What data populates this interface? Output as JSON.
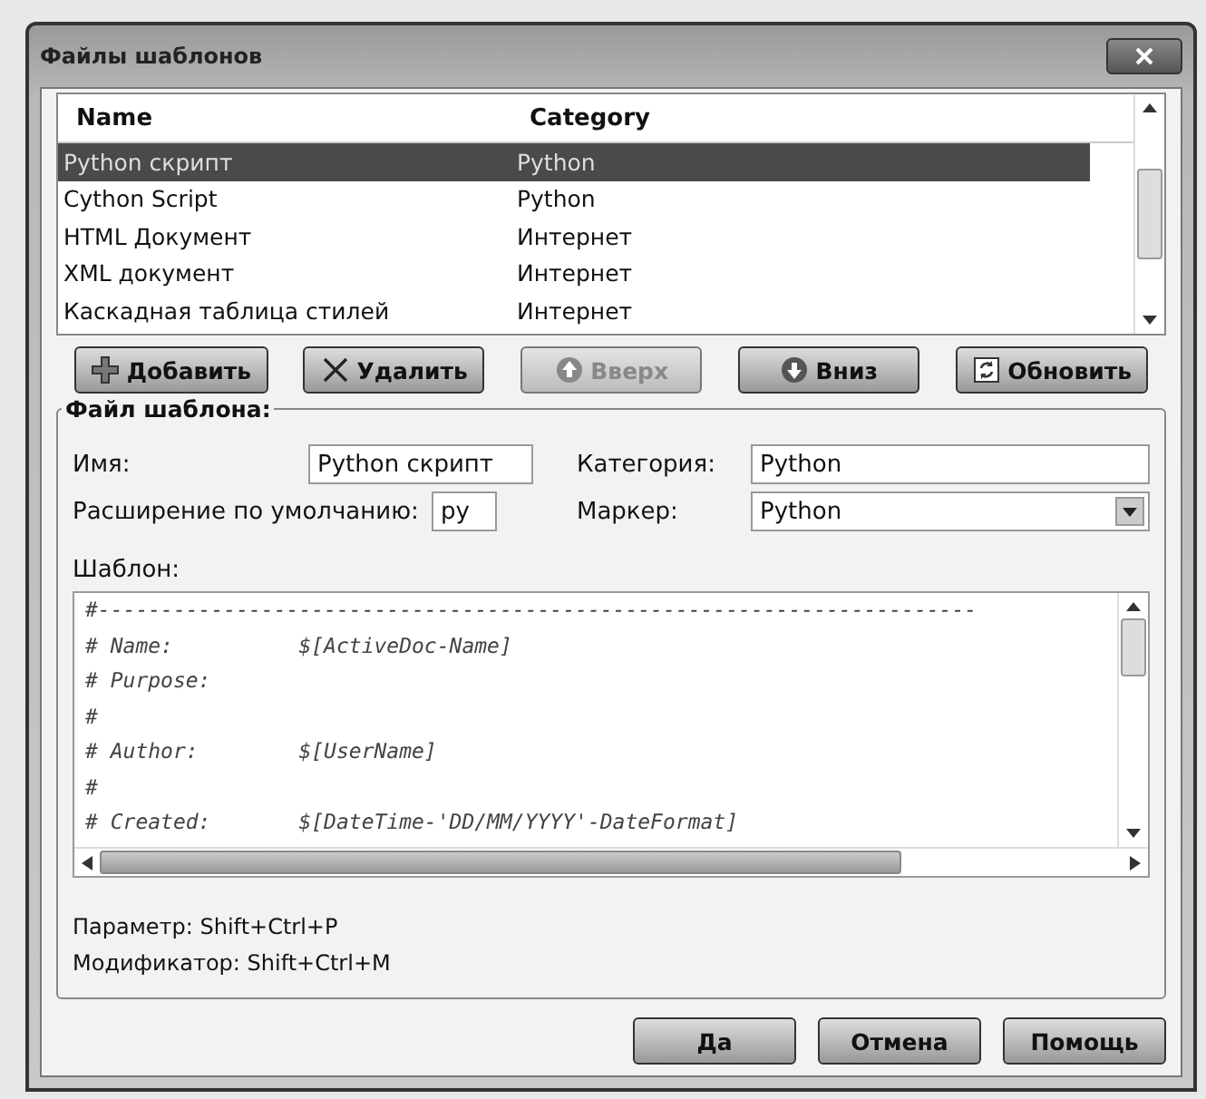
{
  "window": {
    "title": "Файлы шаблонов"
  },
  "table": {
    "columns": [
      "Name",
      "Category"
    ],
    "rows": [
      {
        "name": "Python скрипт",
        "category": "Python",
        "selected": true
      },
      {
        "name": "Cython Script",
        "category": "Python",
        "selected": false
      },
      {
        "name": "HTML Документ",
        "category": "Интернет",
        "selected": false
      },
      {
        "name": "XML документ",
        "category": "Интернет",
        "selected": false
      },
      {
        "name": "Каскадная таблица стилей",
        "category": "Интернет",
        "selected": false
      }
    ]
  },
  "list_buttons": [
    {
      "label": "Добавить",
      "kind": "add",
      "disabled": false
    },
    {
      "label": "Удалить",
      "kind": "delete",
      "disabled": false
    },
    {
      "label": "Вверх",
      "kind": "up",
      "disabled": true
    },
    {
      "label": "Вниз",
      "kind": "down",
      "disabled": false
    },
    {
      "label": "Обновить",
      "kind": "refresh",
      "disabled": false
    }
  ],
  "template_file": {
    "legend": "Файл шаблона:",
    "name_label": "Имя:",
    "name_value": "Python скрипт",
    "category_label": "Категория:",
    "category_value": "Python",
    "extension_label": "Расширение по умолчанию:",
    "extension_value": "py",
    "marker_label": "Маркер:",
    "marker_value": "Python",
    "template_label": "Шаблон:",
    "template_lines": [
      "#----------------------------------------------------------------------",
      "# Name:          $[ActiveDoc-Name]",
      "# Purpose:",
      "#",
      "# Author:        $[UserName]",
      "#",
      "# Created:       $[DateTime-'DD/MM/YYYY'-DateFormat]"
    ],
    "hints": [
      "Параметр: Shift+Ctrl+P",
      "Модификатор: Shift+Ctrl+M"
    ]
  },
  "dialog_buttons": [
    "Да",
    "Отмена",
    "Помощь"
  ]
}
